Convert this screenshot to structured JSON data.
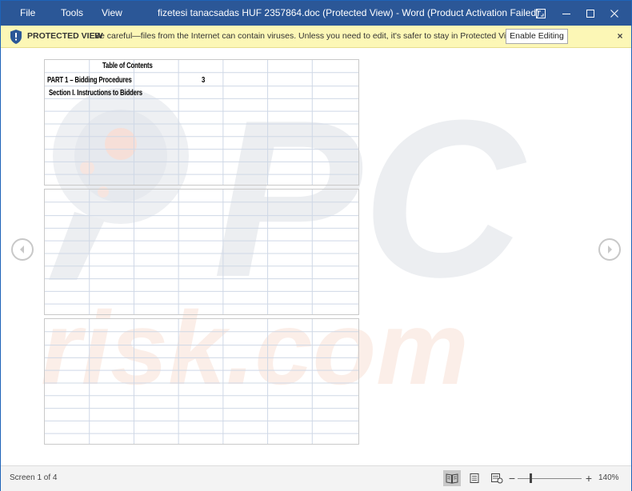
{
  "titlebar": {
    "menu": [
      "File",
      "Tools",
      "View"
    ],
    "title": "fizetesi tanacsadas HUF 2357864.doc (Protected View) - Word (Product Activation Failed)"
  },
  "protected_view": {
    "label": "PROTECTED VIEW",
    "message": "Be careful—files from the Internet can contain viruses. Unless you need to edit, it's safer to stay in Protected View.",
    "button": "Enable Editing",
    "close": "×"
  },
  "document": {
    "toc_title": "Table of Contents",
    "part1": "PART 1 – Bidding Procedures",
    "part1_page": "3",
    "section1": "Section I. Instructions to Bidders"
  },
  "watermark": {
    "line1": "PC",
    "line2": "risk.com"
  },
  "statusbar": {
    "screen": "Screen 1 of 4",
    "zoom_minus": "−",
    "zoom_plus": "+",
    "zoom_level": "140%"
  }
}
